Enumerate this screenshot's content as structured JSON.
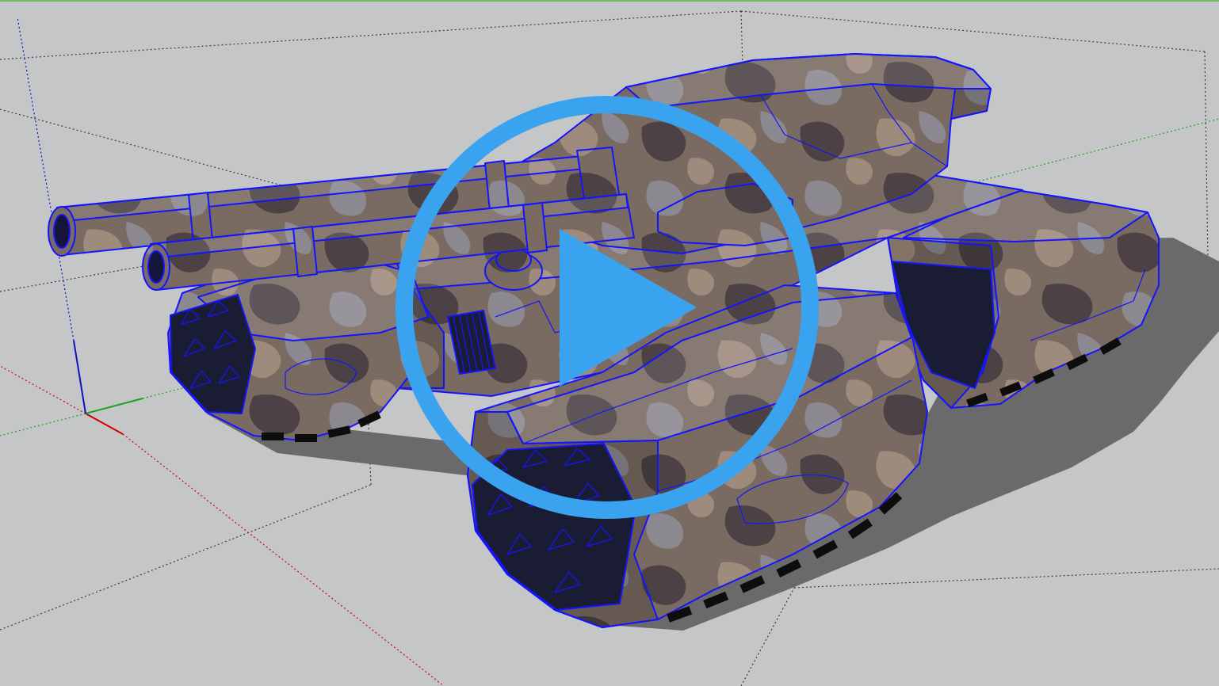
{
  "viewport": {
    "background": "#c5c6c8",
    "top_border": "#6cbf5a"
  },
  "axes": {
    "red": "#d40000",
    "green": "#1aa31a",
    "blue": "#1010c8",
    "guide": "#3c3c3c"
  },
  "model": {
    "edge": "#1414ff",
    "camo_base": "#7a6b62",
    "camo_dark": "#4c4246",
    "camo_light": "#9e8b7c",
    "camo_grey": "#8c8890",
    "tread": "#1a1c34",
    "pads": "#0d0d0d",
    "bore": "#15153a"
  },
  "shadow": "#6a6a6c",
  "play_button": {
    "icon": "play-icon",
    "ring_icon": "circle-icon",
    "color": "#3aa3ef"
  }
}
